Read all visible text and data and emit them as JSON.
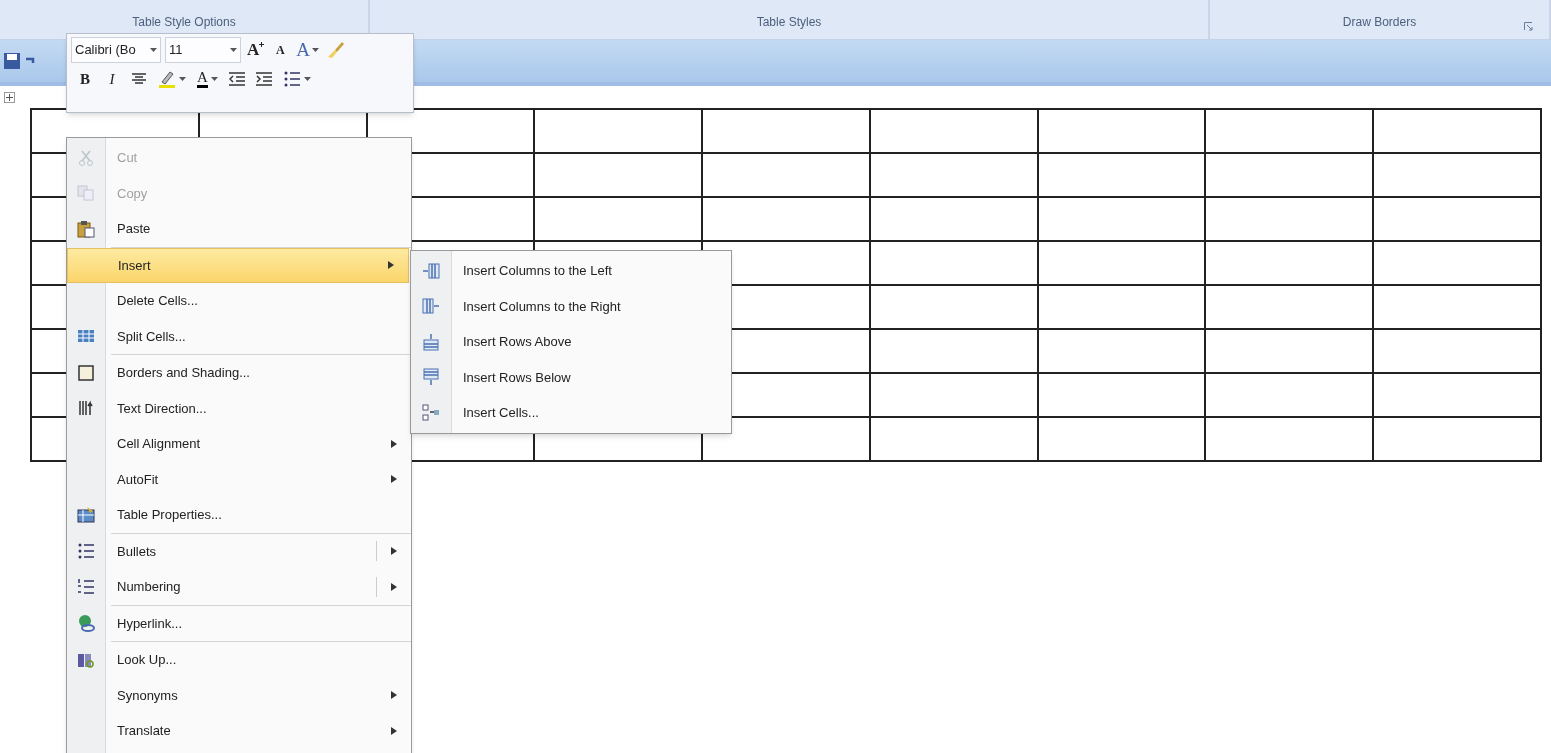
{
  "ribbon_groups": [
    {
      "label": "Table Style Options",
      "launcher": false
    },
    {
      "label": "Table Styles",
      "launcher": false
    },
    {
      "label": "Draw Borders",
      "launcher": true
    }
  ],
  "mini_toolbar": {
    "font": "Calibri (Bo",
    "size": "11",
    "row_1": [
      {
        "kind": "grow",
        "label": "A"
      },
      {
        "kind": "shrink",
        "label": "A"
      },
      {
        "kind": "styles",
        "label": "A"
      },
      {
        "kind": "painter"
      }
    ],
    "row_2": [
      {
        "kind": "bold",
        "label": "B"
      },
      {
        "kind": "italic",
        "label": "I"
      },
      {
        "kind": "center"
      },
      {
        "kind": "highlight"
      },
      {
        "kind": "color",
        "label": "A"
      },
      {
        "kind": "outdent"
      },
      {
        "kind": "indent"
      },
      {
        "kind": "bullets"
      }
    ]
  },
  "context_menu": {
    "sections": [
      [
        {
          "label": "Cut",
          "kind": "item",
          "disabled": true,
          "selected": false
        },
        {
          "label": "Copy",
          "kind": "item",
          "disabled": true,
          "selected": false
        },
        {
          "label": "Paste",
          "kind": "item",
          "disabled": false,
          "selected": false
        }
      ],
      [
        {
          "label": "Insert",
          "kind": "submenu",
          "disabled": false,
          "selected": true
        },
        {
          "label": "Delete Cells...",
          "kind": "item",
          "disabled": false,
          "selected": false
        },
        {
          "label": "Split Cells...",
          "kind": "item",
          "disabled": false,
          "selected": false
        }
      ],
      [
        {
          "label": "Borders and Shading...",
          "kind": "item",
          "disabled": false,
          "selected": false
        },
        {
          "label": "Text Direction...",
          "kind": "item",
          "disabled": false,
          "selected": false
        },
        {
          "label": "Cell Alignment",
          "kind": "submenu",
          "disabled": false,
          "selected": false
        },
        {
          "label": "AutoFit",
          "kind": "submenu",
          "disabled": false,
          "selected": false
        },
        {
          "label": "Table Properties...",
          "kind": "item",
          "disabled": false,
          "selected": false
        }
      ],
      [
        {
          "label": "Bullets",
          "kind": "split",
          "disabled": false,
          "selected": false
        },
        {
          "label": "Numbering",
          "kind": "split",
          "disabled": false,
          "selected": false
        }
      ],
      [
        {
          "label": "Hyperlink...",
          "kind": "item",
          "disabled": false,
          "selected": false
        }
      ],
      [
        {
          "label": "Look Up...",
          "kind": "item",
          "disabled": false,
          "selected": false
        },
        {
          "label": "Synonyms",
          "kind": "submenu",
          "disabled": false,
          "selected": false
        },
        {
          "label": "Translate",
          "kind": "submenu",
          "disabled": false,
          "selected": false
        }
      ]
    ]
  },
  "submenu": [
    {
      "label": "Insert Columns to the Left"
    },
    {
      "label": "Insert Columns to the Right"
    },
    {
      "label": "Insert Rows Above"
    },
    {
      "label": "Insert Rows Below"
    },
    {
      "label": "Insert Cells..."
    }
  ]
}
